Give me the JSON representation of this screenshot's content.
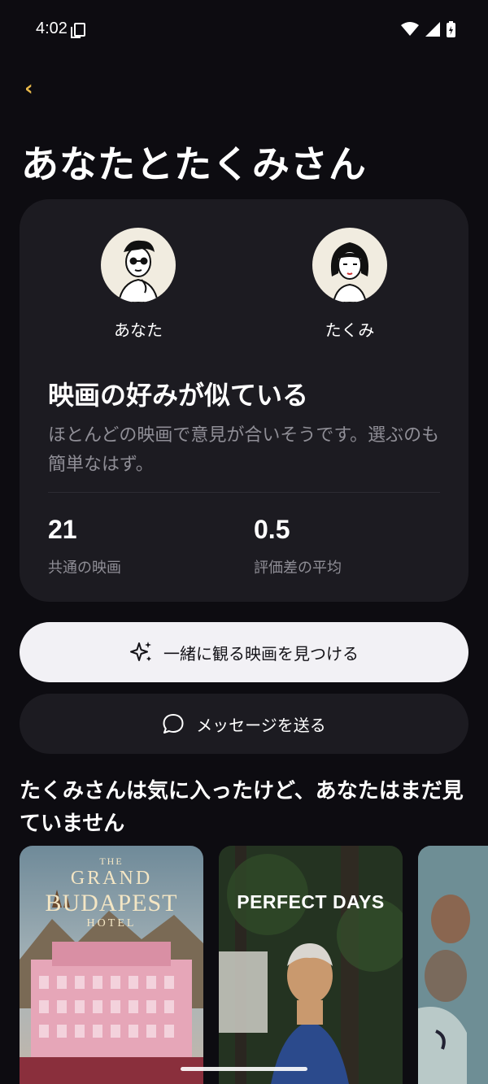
{
  "status": {
    "time": "4:02"
  },
  "header": {
    "title": "あなたとたくみさん"
  },
  "comparison": {
    "you": {
      "name": "あなた"
    },
    "friend": {
      "name": "たくみ"
    },
    "headline": "映画の好みが似ている",
    "description": "ほとんどの映画で意見が合いそうです。選ぶのも簡単なはず。",
    "stats": [
      {
        "value": "21",
        "label": "共通の映画"
      },
      {
        "value": "0.5",
        "label": "評価差の平均"
      }
    ]
  },
  "actions": {
    "find_label": "一緒に観る映画を見つける",
    "message_label": "メッセージを送る"
  },
  "section": {
    "title": "たくみさんは気に入ったけど、あなたはまだ見ていません",
    "posters": [
      {
        "line1": "THE",
        "line2": "GRAND",
        "line3": "BUDAPEST",
        "line4": "HOTEL"
      },
      {
        "title": "PERFECT DAYS"
      },
      {
        "title": ""
      }
    ]
  },
  "colors": {
    "accent": "#e8b84a",
    "background": "#0d0c11",
    "card": "#1c1b21"
  }
}
